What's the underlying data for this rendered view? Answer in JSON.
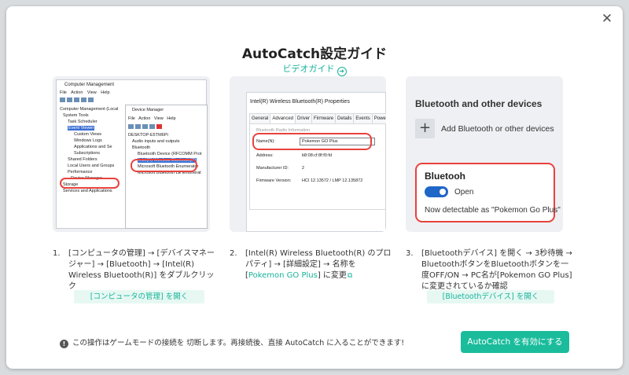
{
  "dialog": {
    "close_icon": "close-icon",
    "title": "AutoCatch設定ガイド",
    "video_link": "ビデオガイド"
  },
  "panel1": {
    "window_title": "Computer Management",
    "menu": "File  Action  View  Help",
    "tree": [
      "Computer Management (Local",
      "System Tools",
      "Task Scheduler",
      "Event Viewer",
      "Custom Views",
      "Windows Logs",
      "Applications and Se",
      "Subscriptions",
      "Shared Folders",
      "Local Users and Groups",
      "Performance",
      "Device Manager",
      "Storage",
      "Services and Applications"
    ],
    "subwindow_title": "Device Manager",
    "submenu": "File  Action  View  Help",
    "subtree": [
      "DESKTOP-E5TM6PI",
      "Audio inputs and outputs",
      "Bluetooth",
      "Bluetooth Device (RFCOMM Prot",
      "Intel(R) Wireless Bluetooth(R)",
      "Microsoft Bluetooth Enumerator",
      "Microsoft Bluetooth LE Enumerat"
    ]
  },
  "panel2": {
    "window_title": "Intel(R) Wireless Bluetooth(R) Properties",
    "tabs": [
      "General",
      "Advanced",
      "Driver",
      "Firmware",
      "Details",
      "Events",
      "Power"
    ],
    "section": "Bluetooth Radio Information",
    "rows": [
      {
        "label": "Name(N):",
        "value": "Pokemon GO Plus"
      },
      {
        "label": "Address:",
        "value": "b8:08:cf:8f:f0:fd"
      },
      {
        "label": "Manufacturer ID:",
        "value": "2"
      },
      {
        "label": "Firmware Version:",
        "value": "HCI 12.13572 / LMP 12.135872"
      }
    ]
  },
  "panel3": {
    "heading": "Bluetooth and other devices",
    "add_label": "Add Bluetooth or other devices",
    "device_name": "Bluetooh",
    "toggle_label": "Open",
    "detectable": "Now detectable as \"Pokemon Go Plus\""
  },
  "steps": [
    {
      "num": "1.",
      "text": "[コンピュータの管理] → [デバイスマネージャー] → [Bluetooth] → [Intel(R) Wireless Bluetooth(R)] をダブルクリック",
      "button": "[コンピュータの管理] を開く"
    },
    {
      "num": "2.",
      "text_before": "[Intel(R) Wireless Bluetooth(R) のプロパティ] → [詳細設定] → 名称を [",
      "highlight": "Pokemon GO Plus",
      "text_after": "] に変更"
    },
    {
      "num": "3.",
      "text": "[Bluetoothデバイス] を開く → 3秒待機 → BluetoothボタンをBluetoothボタンを一度OFF/ON → PC名が[Pokemon GO Plus]に変更されているか確認",
      "button": "[Bluetoothデバイス] を開く"
    }
  ],
  "footer": {
    "note": "この操作はゲームモードの接続を 切断します。再接続後、直接 AutoCatch に入ることができます!",
    "enable_button": "AutoCatch を有効にする"
  }
}
